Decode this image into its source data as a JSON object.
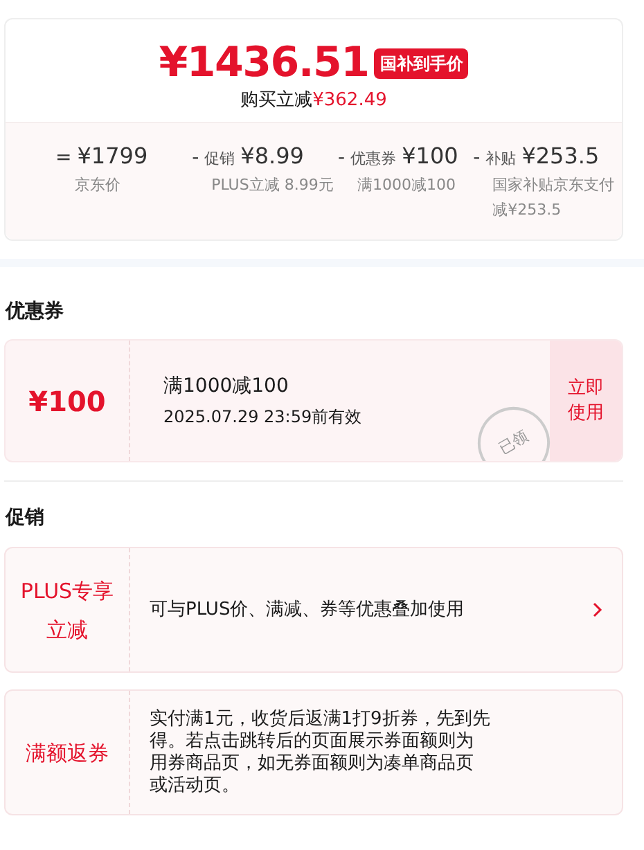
{
  "price": {
    "amount": "¥1436.51",
    "badge": "国补到手价",
    "saving_label": "购买立减",
    "saving_amount": "¥362.49"
  },
  "breakdown": [
    {
      "operator": "=",
      "amount": "¥1799",
      "note": "京东价"
    },
    {
      "operator": "-",
      "label": "促销",
      "amount": "¥8.99",
      "note": "PLUS立减 8.99元"
    },
    {
      "operator": "-",
      "label": "优惠券",
      "amount": "¥100",
      "note": "满1000减100"
    },
    {
      "operator": "-",
      "label": "补贴",
      "amount": "¥253.5",
      "note": "国家补贴京东支付减¥253.5"
    }
  ],
  "coupon_section": {
    "title": "优惠券",
    "coupon": {
      "value": "¥100",
      "condition": "满1000减100",
      "validity": "2025.07.29 23:59前有效",
      "stamp": "已领",
      "action": "立即使用"
    }
  },
  "promo_section": {
    "title": "促销",
    "items": [
      {
        "tag": "PLUS专享立减",
        "text": "可与PLUS价、满减、券等优惠叠加使用",
        "arrow": true
      },
      {
        "tag": "满额返券",
        "text": "实付满1元，收货后返满1打9折券，先到先得。若点击跳转后的页面展示券面额则为用券商品页，如无券面额则为凑单商品页或活动页。",
        "arrow": false
      }
    ]
  }
}
